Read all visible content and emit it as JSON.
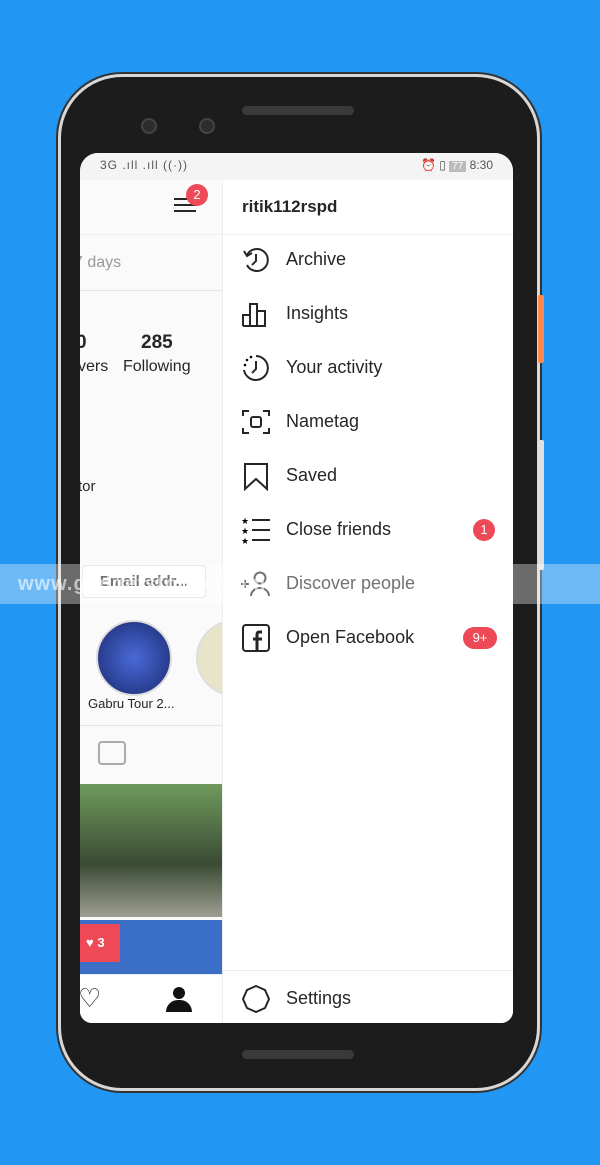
{
  "status_bar": {
    "left": "3G .ıll .ıll ((·))",
    "battery": "77",
    "time": "8:30"
  },
  "profile_bg": {
    "menu_badge": "2",
    "days_text": "7 days",
    "followers_partial": "0",
    "followers_label_partial": "vers",
    "following_count": "285",
    "following_label": "Following",
    "bio_partial": "tor",
    "email_button": "Email addr...",
    "highlight_label": "Gabru Tour 2...",
    "notification_count": "3"
  },
  "drawer": {
    "username": "ritik112rspd",
    "items": [
      {
        "label": "Archive",
        "icon": "archive-clock-icon"
      },
      {
        "label": "Insights",
        "icon": "bar-chart-icon"
      },
      {
        "label": "Your activity",
        "icon": "activity-clock-icon"
      },
      {
        "label": "Nametag",
        "icon": "nametag-scan-icon"
      },
      {
        "label": "Saved",
        "icon": "bookmark-icon"
      },
      {
        "label": "Close friends",
        "icon": "close-friends-list-icon",
        "badge": "1"
      },
      {
        "label": "Discover people",
        "icon": "add-person-icon"
      },
      {
        "label": "Open Facebook",
        "icon": "facebook-icon",
        "badge": "9+"
      }
    ],
    "settings": "Settings"
  },
  "watermark": "www.gadgetstouse.com",
  "colors": {
    "background": "#2196f3",
    "badge": "#ed4956"
  }
}
